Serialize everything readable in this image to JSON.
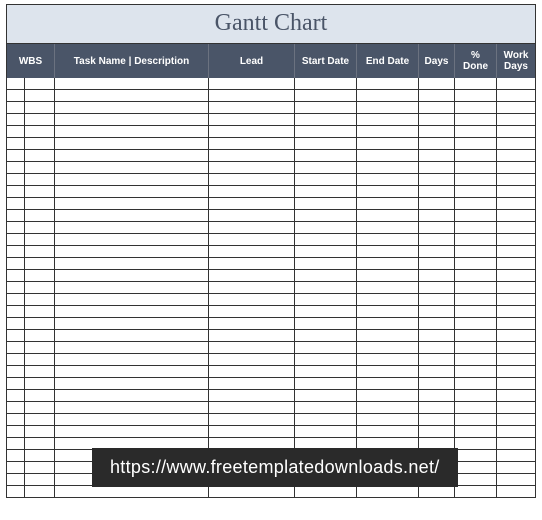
{
  "title": "Gantt Chart",
  "columns": {
    "wbs": "WBS",
    "task": "Task Name | Description",
    "lead": "Lead",
    "start": "Start Date",
    "end": "End Date",
    "days": "Days",
    "pdone": "% Done",
    "wdays": "Work Days"
  },
  "row_count": 35,
  "watermark": "https://www.freetemplatedownloads.net/"
}
